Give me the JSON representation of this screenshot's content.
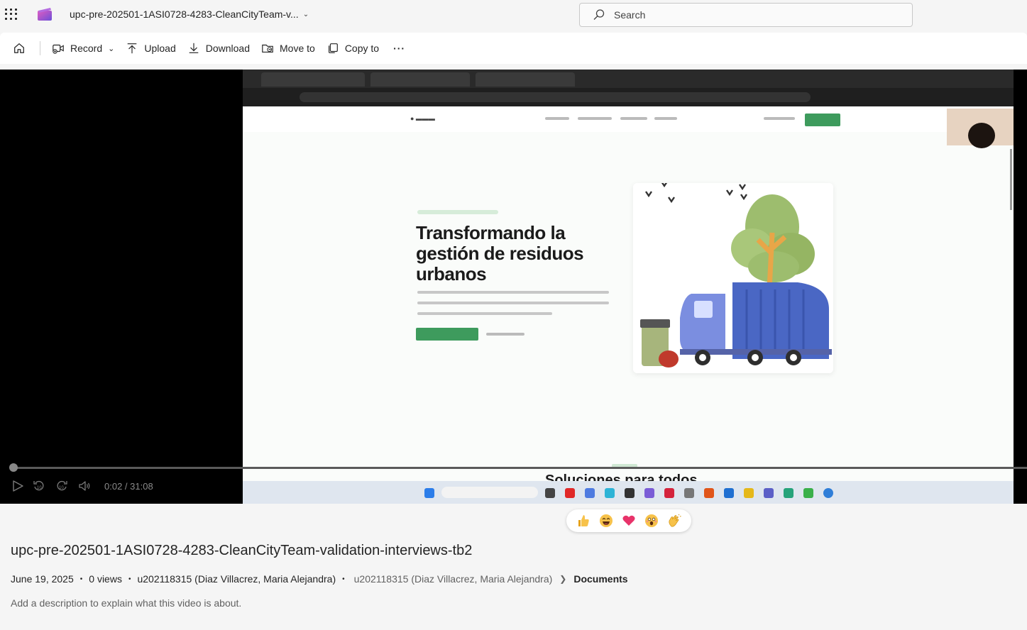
{
  "header": {
    "doc_title": "upc-pre-202501-1ASI0728-4283-CleanCityTeam-v...",
    "search_placeholder": "Search"
  },
  "toolbar": {
    "record": "Record",
    "upload": "Upload",
    "download": "Download",
    "move_to": "Move to",
    "copy_to": "Copy to",
    "more": "···"
  },
  "video_frame": {
    "hero_title": "Transformando la gestión de residuos urbanos",
    "section_title": "Soluciones para todos",
    "brand_color": "#3e9b5d"
  },
  "player": {
    "time": "0:02 / 31:08",
    "progress_fraction": 0.001
  },
  "reactions": [
    "thumbs-up",
    "laugh",
    "heart",
    "surprised",
    "clap"
  ],
  "details": {
    "title": "upc-pre-202501-1ASI0728-4283-CleanCityTeam-validation-interviews-tb2",
    "date": "June 19, 2025",
    "views": "0 views",
    "owner": "u202118315 (Diaz Villacrez, Maria Alejandra)",
    "location_owner": "u202118315 (Diaz Villacrez, Maria Alejandra)",
    "location_folder": "Documents",
    "description_placeholder": "Add a description to explain what this video is about."
  }
}
